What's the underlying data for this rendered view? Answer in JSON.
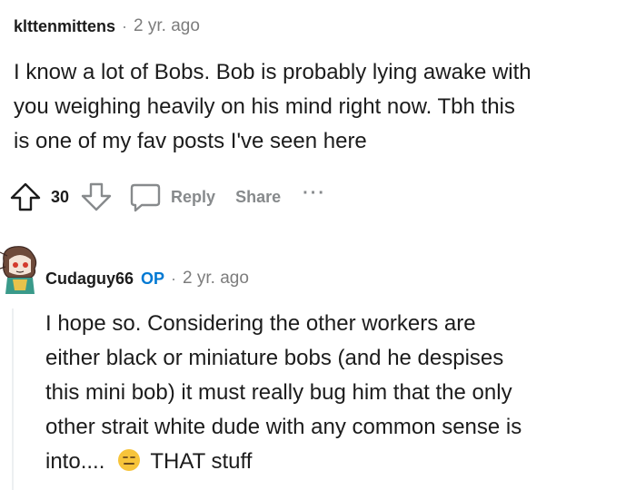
{
  "comment1": {
    "username": "klttenmittens",
    "separator": "·",
    "time": "2 yr. ago",
    "lines": [
      "I know a lot of Bobs. Bob is probably lying awake with",
      "you weighing heavily on his mind right now. Tbh this",
      "is one of my fav posts I've seen here"
    ],
    "votes": "30",
    "reply_label": "Reply",
    "share_label": "Share",
    "more_label": "···"
  },
  "comment2": {
    "username": "Cudaguy66",
    "op_badge": "OP",
    "separator": "·",
    "time": "2 yr. ago",
    "lines": [
      "I hope so. Considering the other workers are",
      "either black or miniature bobs (and he despises",
      "this mini bob) it must really bug him that the only",
      "other strait white dude with any common sense is"
    ],
    "last_line_start": "into....",
    "last_line_end": "THAT stuff"
  },
  "colors": {
    "op_blue": "#0079d3",
    "muted_gray": "#878a8c",
    "emoji_yellow": "#f7c43a"
  }
}
